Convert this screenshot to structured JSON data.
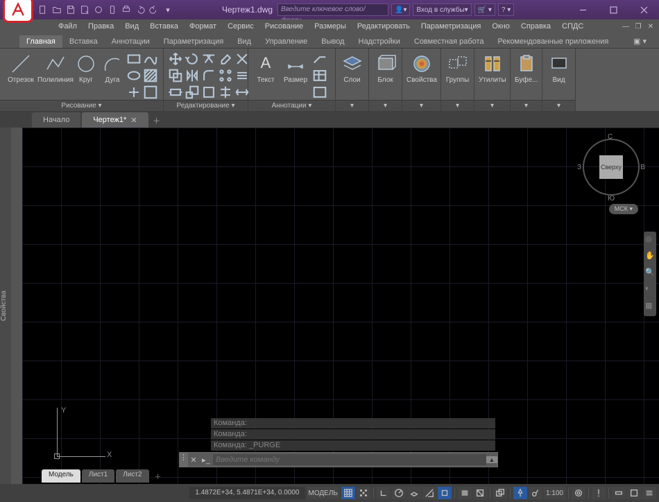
{
  "title_doc": "Чертеж1.dwg",
  "search_placeholder": "Введите ключевое слово/фразу",
  "login_label": "Вход в службы",
  "menubar": [
    "Файл",
    "Правка",
    "Вид",
    "Вставка",
    "Формат",
    "Сервис",
    "Рисование",
    "Размеры",
    "Редактировать",
    "Параметризация",
    "Окно",
    "Справка",
    "СПДС"
  ],
  "ribbon_tabs": [
    "Главная",
    "Вставка",
    "Аннотации",
    "Параметризация",
    "Вид",
    "Управление",
    "Вывод",
    "Надстройки",
    "Совместная работа",
    "Рекомендованные приложения"
  ],
  "panels": {
    "draw": {
      "title": "Рисование ▾",
      "line": "Отрезок",
      "pline": "Полилиния",
      "circle": "Круг",
      "arc": "Дуга"
    },
    "modify": {
      "title": "Редактирование ▾"
    },
    "annot": {
      "title": "Аннотации ▾",
      "text": "Текст",
      "dim": "Размер"
    },
    "layers": {
      "title": "Слои"
    },
    "block": {
      "title": "Блок"
    },
    "props": {
      "title": "Свойства"
    },
    "groups": {
      "title": "Группы"
    },
    "utils": {
      "title": "Утилиты"
    },
    "clipboard": {
      "title": "Буфе..."
    },
    "view": {
      "title": "Вид"
    }
  },
  "doctabs": {
    "start": "Начало",
    "doc": "Чертеж1*"
  },
  "side_palette": "Свойства",
  "axes": {
    "x": "X",
    "y": "Y"
  },
  "viewcube": {
    "top": "Сверху",
    "n": "С",
    "e": "В",
    "s": "Ю",
    "w": "З"
  },
  "wcs": "МСК ▾",
  "cmd_history": [
    "Команда:",
    "Команда:",
    "Команда: _PURGE"
  ],
  "cmd_placeholder": "Введите команду",
  "layout_tabs": {
    "model": "Модель",
    "l1": "Лист1",
    "l2": "Лист2"
  },
  "status": {
    "coords": "1.4872E+34, 5.4871E+34, 0.0000",
    "model": "МОДЕЛЬ",
    "scale": "1:100"
  }
}
